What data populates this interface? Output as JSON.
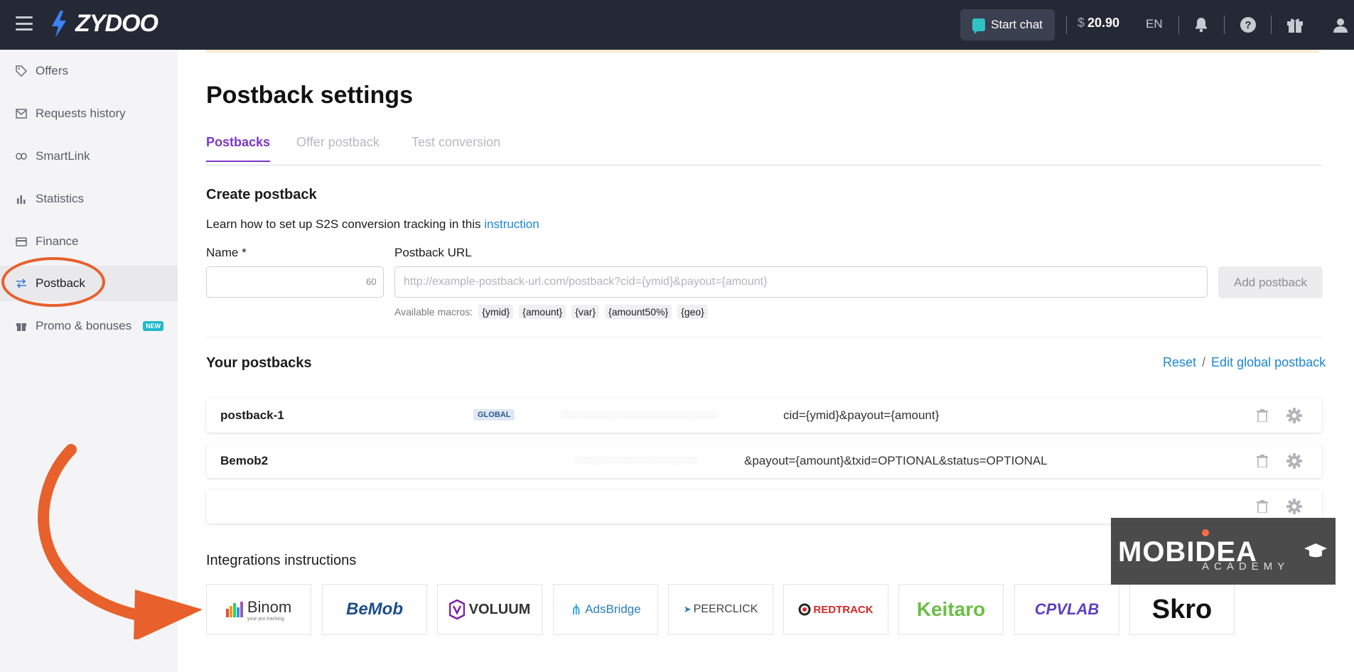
{
  "topbar": {
    "logo_text": "ZYDOO",
    "start_chat_label": "Start chat",
    "currency": "$",
    "balance": "20.90",
    "lang": "EN"
  },
  "sidebar": {
    "items": [
      {
        "label": "Offers",
        "icon": "tag-icon"
      },
      {
        "label": "Requests history",
        "icon": "mail-icon"
      },
      {
        "label": "SmartLink",
        "icon": "link-icon"
      },
      {
        "label": "Statistics",
        "icon": "bar-chart-icon"
      },
      {
        "label": "Finance",
        "icon": "card-icon"
      },
      {
        "label": "Postback",
        "icon": "swap-icon"
      },
      {
        "label": "Promo & bonuses",
        "icon": "gift-icon",
        "badge": "NEW"
      }
    ],
    "active": "Postback"
  },
  "main": {
    "title": "Postback settings",
    "tabs": [
      {
        "label": "Postbacks"
      },
      {
        "label": "Offer postback"
      },
      {
        "label": "Test conversion"
      }
    ],
    "create": {
      "heading": "Create postback",
      "learn_text": "Learn how to set up S2S conversion tracking in this",
      "learn_link": "instruction",
      "name_label": "Name *",
      "name_counter": "60",
      "url_label": "Postback URL",
      "url_placeholder": "http://example-postback-url.com/postback?cid={ymid}&payout={amount}",
      "add_button": "Add postback",
      "macros_label": "Available macros:",
      "macros": [
        "{ymid}",
        "{amount}",
        "{var}",
        "{amount50%}",
        "{geo}"
      ]
    },
    "your_postbacks": {
      "heading": "Your postbacks",
      "reset_label": "Reset",
      "slash": "/",
      "edit_global_label": "Edit global postback",
      "rows": [
        {
          "name": "postback-1",
          "badge": "GLOBAL",
          "url_visible": "cid={ymid}&payout={amount}"
        },
        {
          "name": "Bemob2",
          "badge": "",
          "url_visible": "&payout={amount}&txid=OPTIONAL&status=OPTIONAL"
        },
        {
          "name": "",
          "badge": "",
          "url_visible": ""
        }
      ]
    },
    "integrations": {
      "heading": "Integrations instructions",
      "logos": [
        "Binom",
        "BeMob",
        "VOLUUM",
        "AdsBridge",
        "PEERCLICK",
        "REDTRACK",
        "Keitaro",
        "CPVLAB",
        "Skro"
      ],
      "binom_tagline": "your pro tracking"
    }
  },
  "watermark": {
    "title": "MOBIDEA",
    "subtitle": "ACADEMY"
  },
  "colors": {
    "topbar_bg": "#252936",
    "accent_purple": "#7b37c8",
    "link_blue": "#1c86d6",
    "annotation_orange": "#e8602c"
  }
}
